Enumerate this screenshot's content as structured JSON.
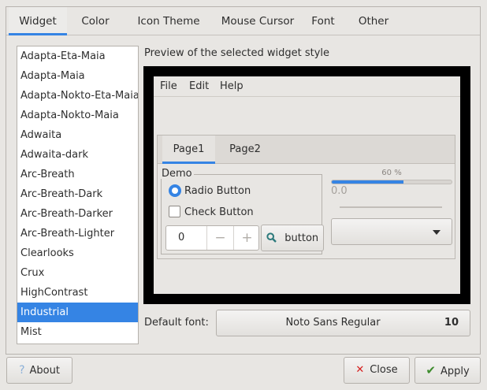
{
  "tabs": [
    "Widget",
    "Color",
    "Icon Theme",
    "Mouse Cursor",
    "Font",
    "Other"
  ],
  "themes": [
    "Adapta-Eta-Maia",
    "Adapta-Maia",
    "Adapta-Nokto-Eta-Maia",
    "Adapta-Nokto-Maia",
    "Adwaita",
    "Adwaita-dark",
    "Arc-Breath",
    "Arc-Breath-Dark",
    "Arc-Breath-Darker",
    "Arc-Breath-Lighter",
    "Clearlooks",
    "Crux",
    "HighContrast",
    "Industrial",
    "Mist"
  ],
  "selected_theme": "Industrial",
  "preview": {
    "title": "Preview of the selected widget style",
    "menu": [
      "File",
      "Edit",
      "Help"
    ],
    "tabs": [
      "Page1",
      "Page2"
    ],
    "group_label": "Demo",
    "radio_label": "Radio Button",
    "check_label": "Check Button",
    "spin_value": "0",
    "spin_minus": "−",
    "spin_plus": "+",
    "button_label": "button",
    "progress_label": "60 %",
    "progress": 0.6,
    "slider_value": "0.0"
  },
  "font": {
    "label": "Default font:",
    "name": "Noto Sans Regular",
    "size": "10"
  },
  "buttons": {
    "about": "About",
    "close": "Close",
    "apply": "Apply"
  },
  "colors": {
    "accent": "#3584e4"
  }
}
